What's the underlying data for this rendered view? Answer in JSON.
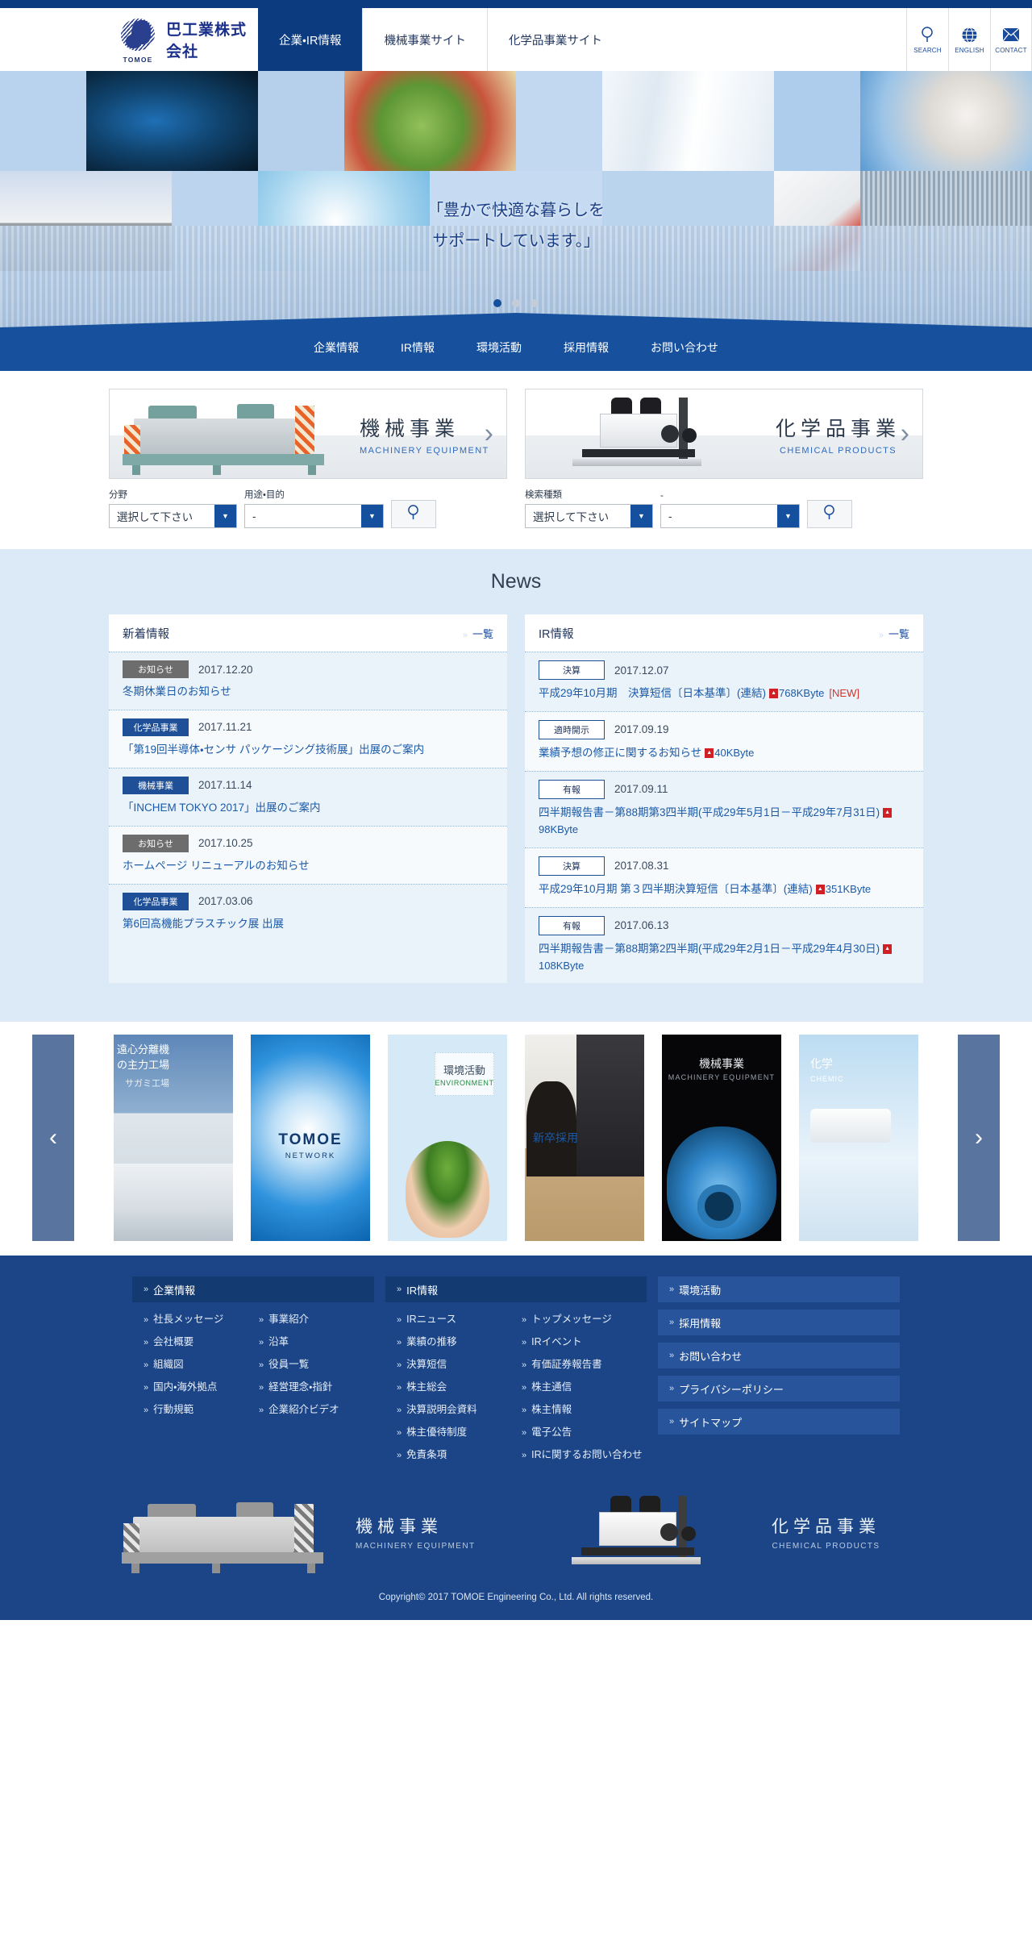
{
  "header": {
    "logo_text": "巴工業株式会社",
    "logo_mark_label": "TOMOE",
    "nav": [
      {
        "label": "企業・IR情報",
        "active": true
      },
      {
        "label": "機械事業サイト",
        "active": false
      },
      {
        "label": "化学品事業サイト",
        "active": false
      }
    ],
    "utils": [
      {
        "label": "SEARCH",
        "icon": "search-icon"
      },
      {
        "label": "ENGLISH",
        "icon": "globe-icon"
      },
      {
        "label": "CONTACT",
        "icon": "mail-icon"
      }
    ]
  },
  "hero": {
    "tagline_line1": "「豊かで快適な暮らしを",
    "tagline_line2": "サポートしています。」",
    "slider_dots": 3,
    "slider_active_index": 0,
    "nav": [
      "企業情報",
      "IR情報",
      "環境活動",
      "採用情報",
      "お問い合わせ"
    ]
  },
  "business": [
    {
      "title_jp": "機械事業",
      "title_en": "MACHINERY EQUIPMENT",
      "image": "decanter-centrifuge-photo",
      "search": {
        "field1_label": "分野",
        "field1_value": "選択して下さい",
        "field2_label": "用途・目的",
        "field2_value": "-",
        "button_icon": "search-icon"
      }
    },
    {
      "title_jp": "化学品事業",
      "title_en": "CHEMICAL PRODUCTS",
      "image": "microscope-photo",
      "search": {
        "field1_label": "検索種類",
        "field1_value": "選択して下さい",
        "field2_label": "-",
        "field2_value": "-",
        "button_icon": "search-icon"
      }
    }
  ],
  "news": {
    "section_title": "News",
    "columns": [
      {
        "heading": "新着情報",
        "more_label": "一覧",
        "items": [
          {
            "tag": "お知らせ",
            "tag_style": "gray",
            "date": "2017.12.20",
            "text": "冬期休業日のお知らせ"
          },
          {
            "tag": "化学品事業",
            "tag_style": "navy",
            "date": "2017.11.21",
            "text": "「第19回半導体・センサ パッケージング技術展」出展のご案内"
          },
          {
            "tag": "機械事業",
            "tag_style": "navy",
            "date": "2017.11.14",
            "text": "「INCHEM TOKYO 2017」出展のご案内"
          },
          {
            "tag": "お知らせ",
            "tag_style": "gray",
            "date": "2017.10.25",
            "text": "ホームページ リニューアルのお知らせ"
          },
          {
            "tag": "化学品事業",
            "tag_style": "navy",
            "date": "2017.03.06",
            "text": "第6回高機能プラスチック展 出展"
          }
        ]
      },
      {
        "heading": "IR情報",
        "more_label": "一覧",
        "items": [
          {
            "tag": "決算",
            "tag_style": "outline",
            "date": "2017.12.07",
            "text": "平成29年10月期　決算短信〔日本基準〕(連結)",
            "pdf": true,
            "size": "768KByte",
            "badge": "[NEW]"
          },
          {
            "tag": "適時開示",
            "tag_style": "outline",
            "date": "2017.09.19",
            "text": "業績予想の修正に関するお知らせ",
            "pdf": true,
            "size": "40KByte",
            "badge": ""
          },
          {
            "tag": "有報",
            "tag_style": "outline",
            "date": "2017.09.11",
            "text": "四半期報告書－第88期第3四半期(平成29年5月1日－平成29年7月31日)",
            "pdf": true,
            "size": "98KByte",
            "badge": ""
          },
          {
            "tag": "決算",
            "tag_style": "outline",
            "date": "2017.08.31",
            "text": "平成29年10月期 第３四半期決算短信〔日本基準〕(連結)",
            "pdf": true,
            "size": "351KByte",
            "badge": ""
          },
          {
            "tag": "有報",
            "tag_style": "outline",
            "date": "2017.06.13",
            "text": "四半期報告書－第88期第2四半期(平成29年2月1日－平成29年4月30日)",
            "pdf": true,
            "size": "108KByte",
            "badge": ""
          }
        ]
      }
    ]
  },
  "carousel": {
    "prev_icon": "chevron-left-icon",
    "next_icon": "chevron-right-icon",
    "slides": [
      {
        "name": "factory",
        "jp": "遠心分離機\nの主力工場",
        "sub": "サガミ工場"
      },
      {
        "name": "network",
        "t1": "TOMOE",
        "t2": "NETWORK"
      },
      {
        "name": "environment",
        "jp": "環境活動",
        "en": "ENVIRONMENT"
      },
      {
        "name": "recruit",
        "jp": "新卒採用"
      },
      {
        "name": "machinery",
        "jp": "機械事業",
        "en": "MACHINERY EQUIPMENT"
      },
      {
        "name": "chemical",
        "jp": "化学",
        "en": "CHEMIC"
      }
    ]
  },
  "footer": {
    "columns": [
      {
        "heading": "企業情報",
        "left": [
          "社長メッセージ",
          "会社概要",
          "組織図",
          "国内・海外拠点",
          "行動規範"
        ],
        "right": [
          "事業紹介",
          "沿革",
          "役員一覧",
          "経営理念・指針",
          "企業紹介ビデオ"
        ]
      },
      {
        "heading": "IR情報",
        "left": [
          "IRニュース",
          "業績の推移",
          "決算短信",
          "株主総会",
          "決算説明会資料",
          "株主優待制度",
          "免責条項"
        ],
        "right": [
          "トップメッセージ",
          "IRイベント",
          "有価証券報告書",
          "株主通信",
          "株主情報",
          "電子公告",
          "IRに関するお問い合わせ"
        ]
      }
    ],
    "single_links": [
      "環境活動",
      "採用情報",
      "お問い合わせ",
      "プライバシーポリシー",
      "サイトマップ"
    ],
    "banners": [
      {
        "jp": "機械事業",
        "en": "MACHINERY EQUIPMENT"
      },
      {
        "jp": "化学品事業",
        "en": "CHEMICAL PRODUCTS"
      }
    ],
    "copyright": "Copyright© 2017 TOMOE Engineering Co., Ltd. All rights reserved."
  }
}
